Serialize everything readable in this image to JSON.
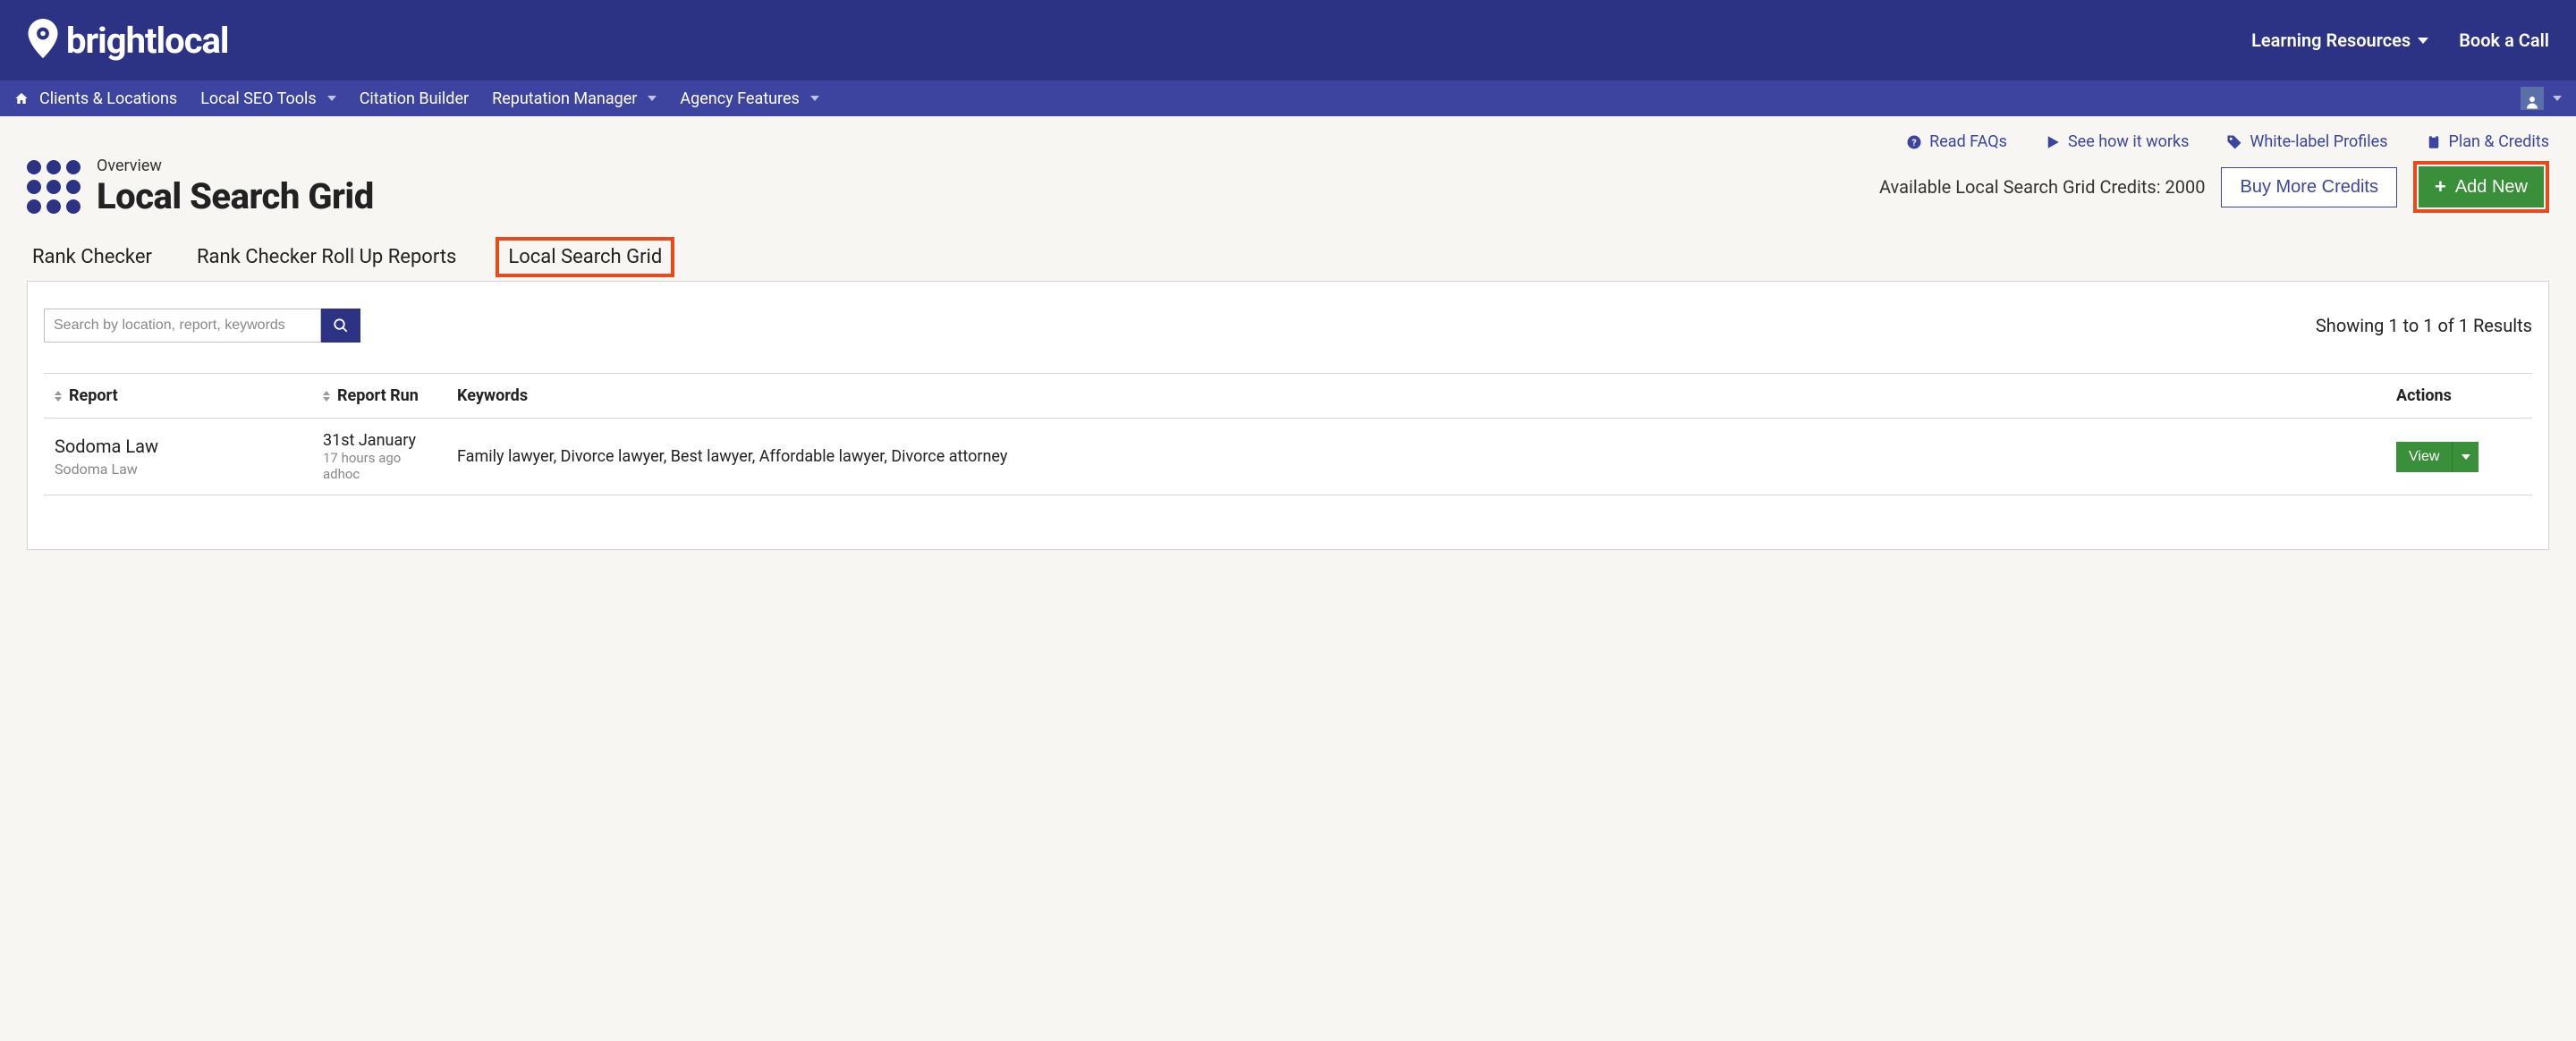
{
  "topbar": {
    "brand": "brightlocal",
    "learning": "Learning Resources",
    "book_call": "Book a Call"
  },
  "nav": {
    "clients": "Clients & Locations",
    "seo_tools": "Local SEO Tools",
    "citation": "Citation Builder",
    "reputation": "Reputation Manager",
    "agency": "Agency Features"
  },
  "context_links": {
    "faqs": "Read FAQs",
    "how": "See how it works",
    "white": "White-label Profiles",
    "plan": "Plan & Credits"
  },
  "page": {
    "overview": "Overview",
    "title": "Local Search Grid",
    "credits_text": "Available Local Search Grid Credits: 2000",
    "buy_more": "Buy More Credits",
    "add_new": "Add New"
  },
  "tabs": {
    "rank_checker": "Rank Checker",
    "rollup": "Rank Checker Roll Up Reports",
    "lsg": "Local Search Grid"
  },
  "panel": {
    "search_placeholder": "Search by location, report, keywords",
    "showing": "Showing 1 to 1 of 1 Results"
  },
  "columns": {
    "report": "Report",
    "run": "Report Run",
    "keywords": "Keywords",
    "actions": "Actions"
  },
  "rows": [
    {
      "name": "Sodoma Law",
      "sub": "Sodoma Law",
      "run_date": "31st January",
      "run_ago": "17 hours ago",
      "run_type": "adhoc",
      "keywords": "Family lawyer, Divorce lawyer, Best lawyer, Affordable lawyer, Divorce attorney",
      "view": "View"
    }
  ]
}
